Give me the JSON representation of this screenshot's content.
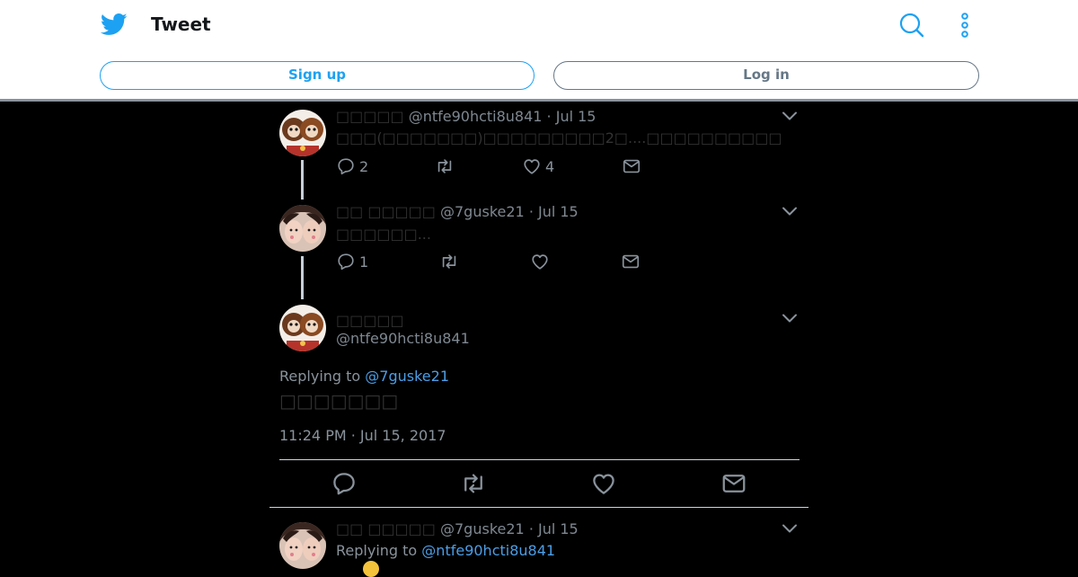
{
  "header": {
    "title": "Tweet",
    "signup_label": "Sign up",
    "login_label": "Log in"
  },
  "colors": {
    "brand": "#1da1f2",
    "background": "#000000",
    "link": "#4c9ee6",
    "muted": "#8a939c"
  },
  "thread": [
    {
      "name": "□□□□□",
      "handle": "@ntfe90hcti8u841",
      "date": "Jul 15",
      "text": "□□□(□□□□□□□)□□□□□□□□□2□....□□□□□□□□□□",
      "replies": "2",
      "likes": "4"
    },
    {
      "name": "□□ □□□□□",
      "handle": "@7guske21",
      "date": "Jul 15",
      "text": "□□□□□□...",
      "replies": "1"
    }
  ],
  "main_tweet": {
    "name": "□□□□□",
    "handle": "@ntfe90hcti8u841",
    "replying_prefix": "Replying to",
    "replying_to": "@7guske21",
    "text": "□□□□□□□",
    "timestamp": "11:24 PM · Jul 15, 2017"
  },
  "reply": {
    "name": "□□ □□□□□",
    "handle": "@7guske21",
    "date": "Jul 15",
    "replying_prefix": "Replying to",
    "replying_to": "@ntfe90hcti8u841"
  },
  "icons": [
    "twitter-bird-icon",
    "search-icon",
    "more-vertical-icon",
    "reply-icon",
    "retweet-icon",
    "like-icon",
    "dm-icon",
    "chevron-down-icon"
  ]
}
